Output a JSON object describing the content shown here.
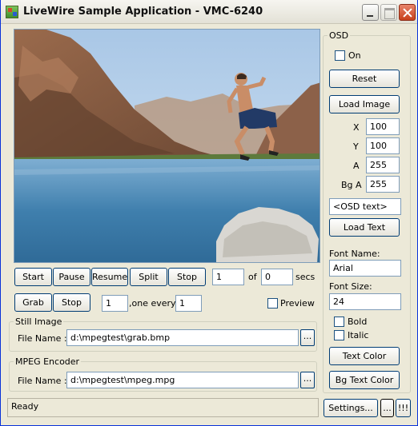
{
  "window": {
    "title": "LiveWire Sample Application - VMC-6240"
  },
  "video": {
    "description_icon": "video-preview"
  },
  "playback": {
    "start": "Start",
    "pause": "Pause",
    "resume": "Resume",
    "split": "Split",
    "stop": "Stop",
    "split_count": "1",
    "of_label": "of",
    "total": "0",
    "secs_label": "secs"
  },
  "grab": {
    "grab": "Grab",
    "stop": "Stop",
    "count": "1",
    "every_label": ",one every",
    "every": "1",
    "preview_label": "Preview",
    "preview_checked": false
  },
  "still_image": {
    "group_title": "Still Image",
    "file_label": "File Name :",
    "file_value": "d:\\mpegtest\\grab.bmp",
    "browse": "..."
  },
  "mpeg_encoder": {
    "group_title": "MPEG Encoder",
    "file_label": "File Name :",
    "file_value": "d:\\mpegtest\\mpeg.mpg",
    "browse": "..."
  },
  "status": {
    "text": "Ready"
  },
  "osd": {
    "group_title": "OSD",
    "on_label": "On",
    "on_checked": false,
    "reset": "Reset",
    "load_image": "Load Image",
    "x_label": "X",
    "x_value": "100",
    "y_label": "Y",
    "y_value": "100",
    "a_label": "A",
    "a_value": "255",
    "bga_label": "Bg A",
    "bga_value": "255",
    "text_value": "<OSD text>",
    "load_text": "Load Text",
    "font_name_label": "Font Name:",
    "font_name_value": "Arial",
    "font_size_label": "Font Size:",
    "font_size_value": "24",
    "bold_label": "Bold",
    "italic_label": "Italic",
    "text_color": "Text Color",
    "bg_text_color": "Bg Text Color"
  },
  "footer": {
    "settings": "Settings...",
    "more": "...",
    "bang": "!!!"
  },
  "colors": {
    "window_bg": "#ece9d8",
    "button_border": "#003c74",
    "field_border": "#7f9db9",
    "close_button": "#c8401c"
  }
}
